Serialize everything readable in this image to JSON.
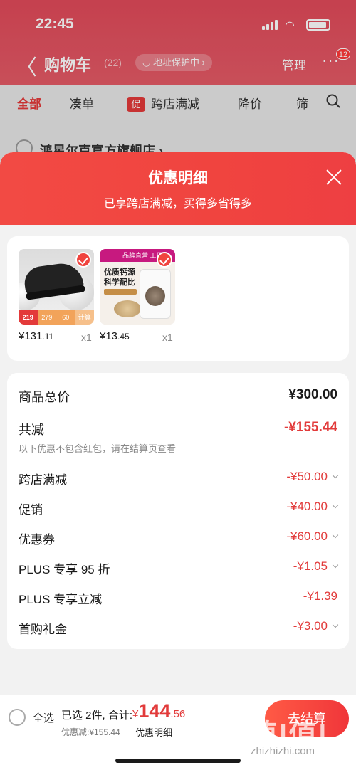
{
  "status_bar": {
    "time": "22:45"
  },
  "nav": {
    "back": "〈",
    "title": "购物车",
    "count": "(22)",
    "address_pill": "◡ 地址保护中 ›",
    "manage": "管理",
    "more": "···",
    "badge": "12"
  },
  "tabs": [
    {
      "label": "全部"
    },
    {
      "label": "凑单"
    },
    {
      "tag": "促",
      "label": "跨店满减"
    },
    {
      "label": "降价"
    },
    {
      "label": "筛"
    }
  ],
  "store": {
    "name": "鸿星尔克官方旗舰店 ›"
  },
  "sheet": {
    "title": "优惠明细",
    "subtitle": "已享跨店满减，买得多省得多",
    "products": [
      {
        "tags": [
          "219",
          "279",
          "60",
          "计算"
        ],
        "price_int": "¥131",
        "price_dec": ".11",
        "qty": "x1"
      },
      {
        "band": "品牌直营 工厂直发",
        "text": "优质钙源\n科学配比",
        "price_int": "¥13",
        "price_dec": ".45",
        "qty": "x1"
      }
    ],
    "goods_total_label": "商品总价",
    "goods_total_value": "¥300.00",
    "discount_label": "共减",
    "discount_value": "-¥155.44",
    "discount_hint": "以下优惠不包含红包，请在结算页查看",
    "items": [
      {
        "label": "跨店满减",
        "value": "-¥50.00",
        "chevron": true
      },
      {
        "label": "促销",
        "value": "-¥40.00",
        "chevron": true
      },
      {
        "label": "优惠券",
        "value": "-¥60.00",
        "chevron": true
      },
      {
        "label": "PLUS 专享 95 折",
        "value": "-¥1.05",
        "chevron": true
      },
      {
        "label": "PLUS 专享立减",
        "value": "-¥1.39",
        "chevron": false
      },
      {
        "label": "首购礼金",
        "value": "-¥3.00",
        "chevron": true
      }
    ]
  },
  "bottom": {
    "select_all": "全选",
    "selected": "已选 2件, 合计:",
    "currency": "¥",
    "total_int": "144",
    "total_dec": ".56",
    "saved": "优惠减:¥155.44",
    "detail_link": "优惠明细",
    "checkout": "去结算"
  },
  "watermark": {
    "main": "值|值|值",
    "sub": "zhizhizhi.com"
  },
  "colors": {
    "accent": "#f0443f",
    "price_red": "#e23b3b"
  }
}
